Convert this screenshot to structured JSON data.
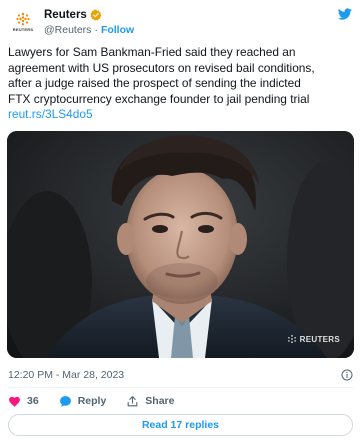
{
  "author": {
    "name": "Reuters",
    "handle": "@Reuters",
    "separator": "·",
    "follow_label": "Follow",
    "avatar_text": "REUTERS",
    "verified_color": "#e8a400"
  },
  "tweet": {
    "lines": [
      "Lawyers for Sam Bankman-Fried said they reached an",
      "agreement with US prosecutors on revised bail conditions,",
      "after a judge raised the prospect of sending the indicted",
      "FTX cryptocurrency exchange founder to jail pending trial"
    ],
    "link": "reut.rs/3LS4do5"
  },
  "photo": {
    "watermark": "REUTERS"
  },
  "timestamp": "12:20 PM - Mar 28, 2023",
  "actions": {
    "like_count": "36",
    "reply_label": "Reply",
    "share_label": "Share"
  },
  "replies_button": "Read 17 replies",
  "colors": {
    "accent": "#1d9bf0",
    "like": "#f91880",
    "text": "#0f1419",
    "secondary": "#536471"
  },
  "icons": [
    "x-logo-icon",
    "verified-badge-icon",
    "info-icon",
    "heart-icon",
    "reply-icon",
    "share-icon"
  ]
}
